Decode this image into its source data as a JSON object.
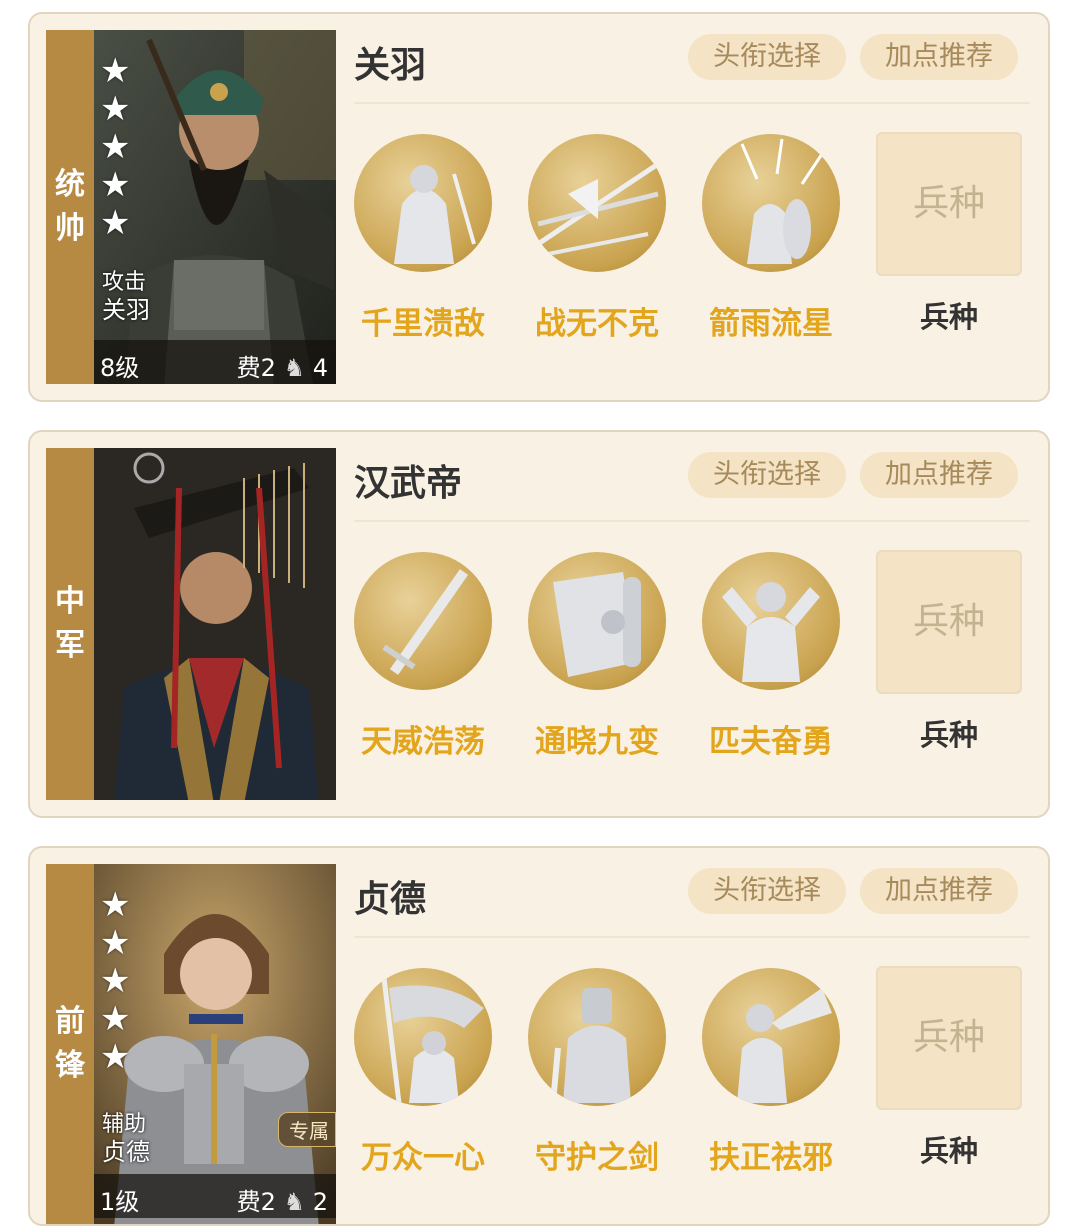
{
  "common": {
    "title_button": "头衔选择",
    "points_button": "加点推荐",
    "troop_box": "兵种",
    "troop_label": "兵种"
  },
  "generals": [
    {
      "position": "统帅",
      "name": "关羽",
      "card_role": "攻击",
      "card_name": "关羽",
      "level": "8级",
      "cost": "费2",
      "move": "4",
      "stars": 5,
      "skills": [
        {
          "name": "千里溃敌",
          "icon": "mounted-warrior-icon"
        },
        {
          "name": "战无不克",
          "icon": "weapons-icon"
        },
        {
          "name": "箭雨流星",
          "icon": "arrow-rain-shield-icon"
        }
      ]
    },
    {
      "position": "中军",
      "name": "汉武帝",
      "stars": 0,
      "skills": [
        {
          "name": "天威浩荡",
          "icon": "sword-icon"
        },
        {
          "name": "通晓九变",
          "icon": "scroll-icon"
        },
        {
          "name": "匹夫奋勇",
          "icon": "strongman-icon"
        }
      ]
    },
    {
      "position": "前锋",
      "name": "贞德",
      "card_role": "辅助",
      "card_name": "贞德",
      "level": "1级",
      "cost": "费2",
      "move": "2",
      "exclusive": "专属",
      "stars": 5,
      "skills": [
        {
          "name": "万众一心",
          "icon": "flag-bearer-icon"
        },
        {
          "name": "守护之剑",
          "icon": "armored-knight-icon"
        },
        {
          "name": "扶正祛邪",
          "icon": "horn-blower-icon"
        }
      ]
    }
  ]
}
